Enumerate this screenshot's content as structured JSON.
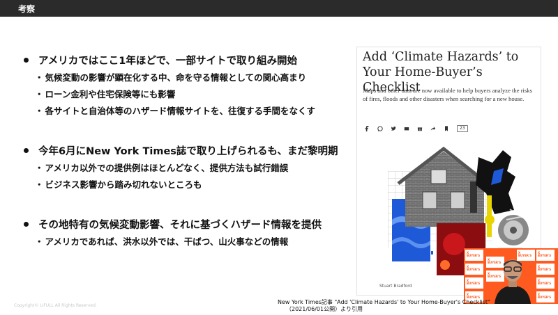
{
  "header": {
    "title": "考察"
  },
  "bullets": [
    {
      "text": "アメリカではここ1年ほどで、一部サイトで取り組み開始",
      "subs": [
        "気候変動の影響が顕在化する中、命を守る情報としての関心高まり",
        "ローン金利や住宅保険等にも影響",
        "各サイトと自治体等のハザード情報サイトを、往復する手間をなくす"
      ]
    },
    {
      "text": "今年6月にNew York Times誌で取り上げられるも、まだ黎明期",
      "subs": [
        "アメリカ以外での提供例はほとんどなく、提供方法も試行錯誤",
        "ビジネス影響から踏み切れないところも"
      ]
    },
    {
      "text": "その地特有の気候変動影響、それに基づくハザード情報を提供",
      "subs": [
        "アメリカであれば、洪水以外では、干ばつ、山火事などの情報"
      ]
    }
  ],
  "sub_marker": "・",
  "article": {
    "title": "Add ‘Climate Hazards’ to Your Home-Buyer’s Checklist",
    "description": "Maps and other data are now available to help buyers analyze the risks of fires, floods and other disasters when searching for a new house.",
    "comment_count": "23",
    "share_icons": [
      "facebook-icon",
      "whatsapp-icon",
      "twitter-icon",
      "email-icon",
      "gift-icon",
      "share-icon",
      "bookmark-icon"
    ],
    "credit": "Stuart Bradford"
  },
  "video": {
    "logo_text": "X BUYER'S"
  },
  "caption": {
    "line1": "New York Times記事 \"Add 'Climate Hazards' to Your Home-Buyer's Checklist\"",
    "line2": "（2021/06/01公開）より引用"
  },
  "footer": {
    "copyright": "Copyright© LIFULL All Rights Reserved."
  },
  "colors": {
    "topbar": "#2b2b2b",
    "accent_orange": "#ff5a1f",
    "flood_blue": "#1e5ad8",
    "fire_red": "#d0181e"
  }
}
